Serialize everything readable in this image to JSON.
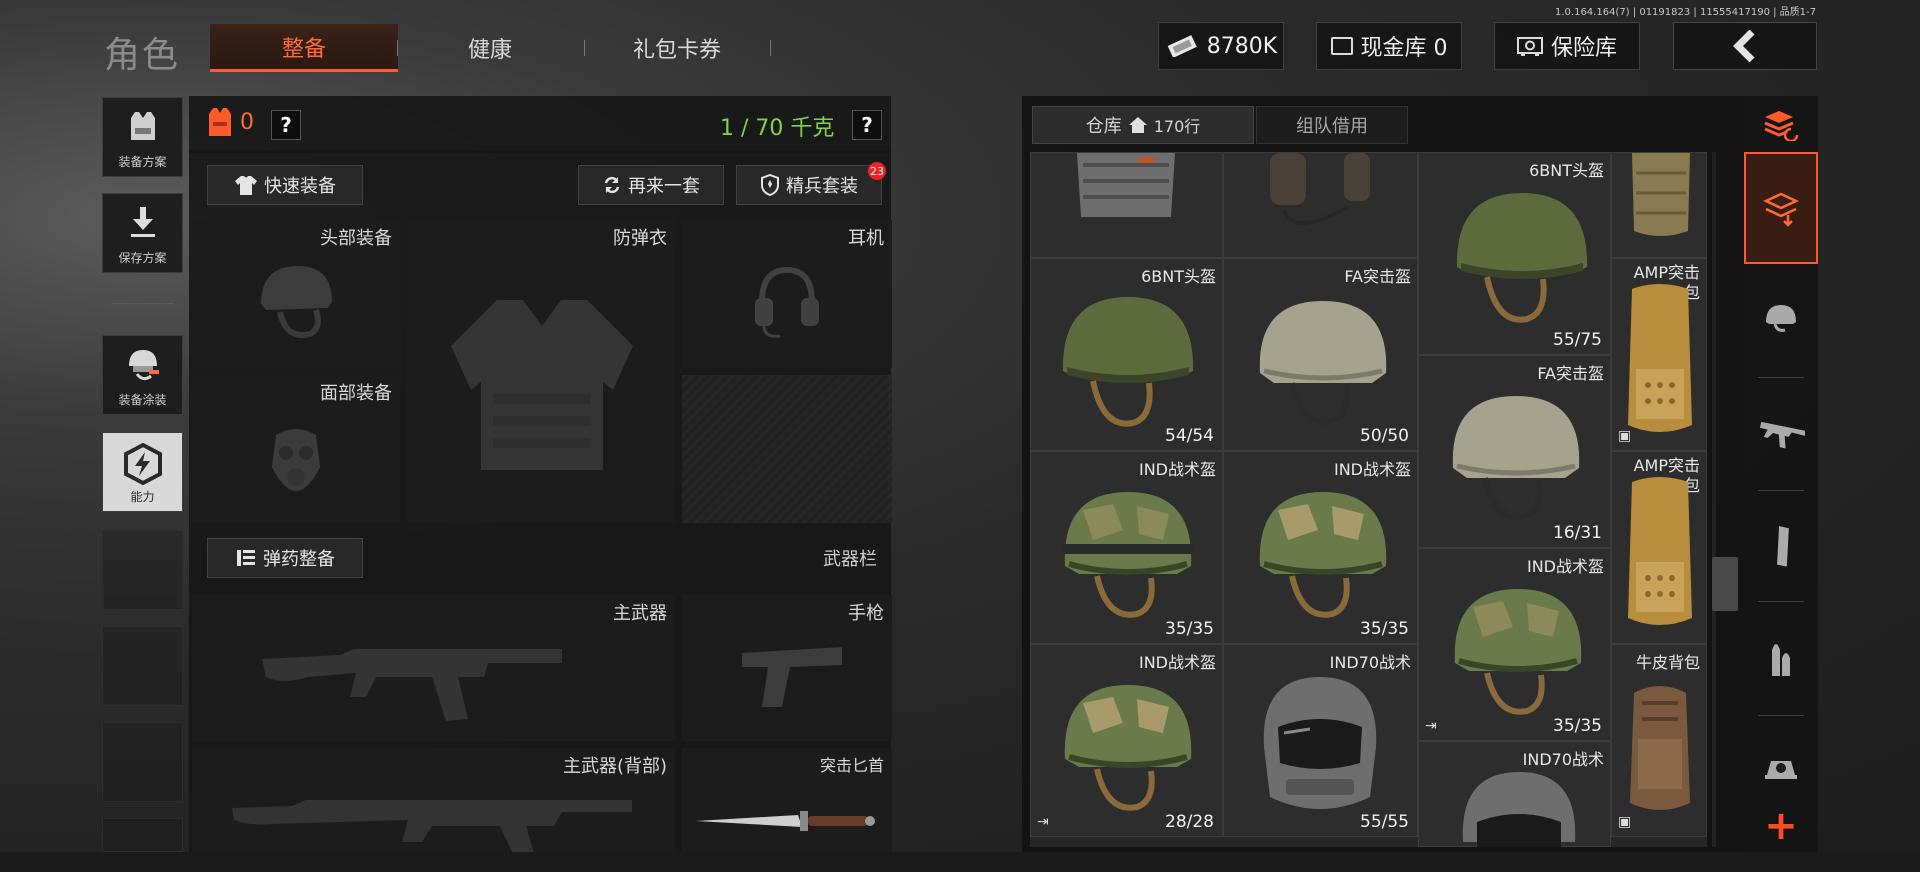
{
  "version": "1.0.164.164(7) | 01191823 | 11555417190 | 品质1-7",
  "header": {
    "title": "角色",
    "tabs": [
      {
        "label": "整备",
        "active": true
      },
      {
        "label": "健康",
        "active": false
      },
      {
        "label": "礼包卡券",
        "active": false
      }
    ],
    "currency": "8780K",
    "cash_vault": "现金库 0",
    "insurance_vault": "保险库"
  },
  "sidebar": {
    "items": [
      {
        "label": "装备方案",
        "icon": "vest-icon"
      },
      {
        "label": "保存方案",
        "icon": "download-icon"
      },
      {
        "label": "装备涂装",
        "icon": "paint-helmet-icon"
      },
      {
        "label": "能力",
        "icon": "ability-hexagon-icon"
      }
    ]
  },
  "loadout": {
    "armor_count": "0",
    "weight": "1 / 70 千克",
    "help": "?",
    "quick_equip": "快速装备",
    "reroll": "再来一套",
    "elite_set": "精兵套装",
    "elite_badge": "23",
    "slots": {
      "head": "头部装备",
      "armor": "防弹衣",
      "headset": "耳机",
      "face": "面部装备"
    },
    "ammo_button": "弹药整备",
    "weapon_bar": "武器栏",
    "weapons": {
      "primary": "主武器",
      "pistol": "手枪",
      "primary_back": "主武器(背部)",
      "knife": "突击匕首"
    }
  },
  "warehouse": {
    "tab_warehouse": "仓库",
    "row_count": "170行",
    "tab_team": "组队借用",
    "items": [
      {
        "name": "6BNT头盔",
        "durability": "55/75"
      },
      {
        "name": "6BNT头盔",
        "durability": "54/54"
      },
      {
        "name": "FA突击盔",
        "durability": "50/50"
      },
      {
        "name": "AMP突击包",
        "durability": ""
      },
      {
        "name": "FA突击盔",
        "durability": "16/31"
      },
      {
        "name": "IND战术盔",
        "durability": "35/35"
      },
      {
        "name": "IND战术盔",
        "durability": "35/35"
      },
      {
        "name": "AMP突击包",
        "durability": ""
      },
      {
        "name": "IND战术盔",
        "durability": "35/35"
      },
      {
        "name": "IND战术盔",
        "durability": "28/28"
      },
      {
        "name": "IND70战术",
        "durability": "55/55"
      },
      {
        "name": "牛皮背包",
        "durability": ""
      },
      {
        "name": "IND70战术",
        "durability": ""
      }
    ],
    "add_symbol": "+"
  },
  "colors": {
    "accent": "#ff5a2a",
    "weight_green": "#7fd24a",
    "helmet_olive": "#5d6b3c",
    "helmet_tan": "#a5a28d",
    "pack_tan": "#b98d3e"
  }
}
